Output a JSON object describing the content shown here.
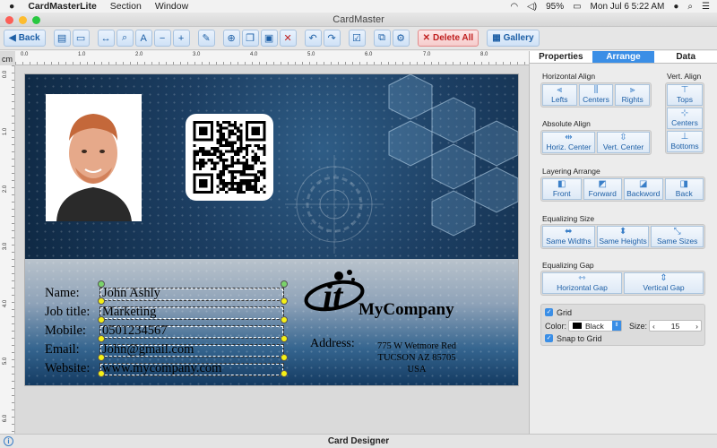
{
  "menubar": {
    "apple": "",
    "app_name": "CardMasterLite",
    "items": [
      "Section",
      "Window"
    ],
    "battery": "95%",
    "clock": "Mon Jul 6  5:22 AM"
  },
  "window": {
    "title": "CardMaster"
  },
  "toolbar": {
    "back_label": "Back",
    "delete_all_label": "Delete All",
    "gallery_label": "Gallery"
  },
  "ruler": {
    "unit": "cm",
    "h_ticks": [
      "0.0",
      "1.0",
      "2.0",
      "3.0",
      "4.0",
      "5.0",
      "6.0",
      "7.0",
      "8.0"
    ],
    "v_ticks": [
      "0.0",
      "1.0",
      "2.0",
      "3.0",
      "4.0",
      "5.0",
      "6.0"
    ]
  },
  "card": {
    "labels": [
      "Name:",
      "Job title:",
      "Mobile:",
      "Email:",
      "Website:"
    ],
    "values": [
      "John Ashly",
      "Marketing",
      "0501234567",
      "John@gmail.com",
      "www.mycompany.com"
    ],
    "company": "MyCompany",
    "address_label": "Address:",
    "address_lines": [
      "775 W Wetmore Red",
      "TUCSON AZ 85705",
      "USA"
    ]
  },
  "panel": {
    "tabs": [
      "Properties",
      "Arrange",
      "Data"
    ],
    "active_tab": "Arrange",
    "horizontal_align": {
      "title": "Horizontal Align",
      "buttons": [
        "Lefts",
        "Centers",
        "Rights"
      ]
    },
    "vert_align": {
      "title": "Vert. Align",
      "buttons": [
        "Tops",
        "Centers",
        "Bottoms"
      ]
    },
    "absolute_align": {
      "title": "Absolute Align",
      "buttons": [
        "Horiz. Center",
        "Vert. Center"
      ]
    },
    "layering": {
      "title": "Layering Arrange",
      "buttons": [
        "Front",
        "Forward",
        "Backword",
        "Back"
      ]
    },
    "equalizing_size": {
      "title": "Equalizing Size",
      "buttons": [
        "Same Widths",
        "Same Heights",
        "Same Sizes"
      ]
    },
    "equalizing_gap": {
      "title": "Equalizing Gap",
      "buttons": [
        "Horizontal Gap",
        "Vertical Gap"
      ]
    },
    "grid": {
      "grid_label": "Grid",
      "color_label": "Color:",
      "color_value": "Black",
      "size_label": "Size:",
      "size_value": "15",
      "snap_label": "Snap to Grid"
    }
  },
  "statusbar": {
    "title": "Card Designer"
  },
  "colors": {
    "accent": "#3a8ee6",
    "card_dark": "#0f2944",
    "delete": "#c02020"
  }
}
